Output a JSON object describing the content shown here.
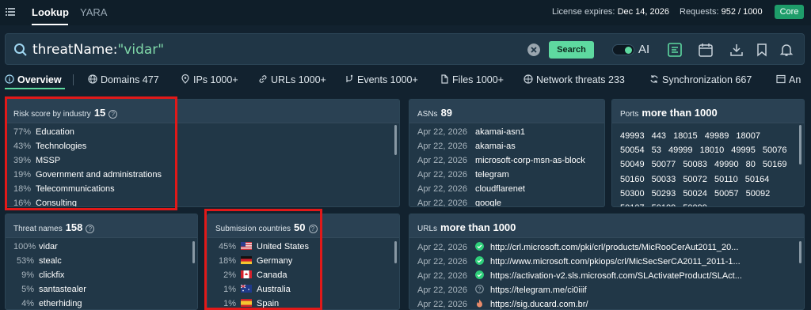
{
  "topbar": {
    "tabs": [
      "Lookup",
      "YARA"
    ],
    "license_label": "License expires:",
    "license_date": "Dec 14, 2026",
    "requests_label": "Requests:",
    "requests_value": "952 / 1000",
    "plan_badge": "Core"
  },
  "search": {
    "query_key": "threatName:",
    "query_value": "\"vidar\"",
    "button_label": "Search",
    "ai_label": "AI"
  },
  "nav": {
    "overview": "Overview",
    "domains": "Domains 477",
    "ips": "IPs 1000+",
    "urls": "URLs 1000+",
    "events": "Events 1000+",
    "files": "Files 1000+",
    "network_threats": "Network threats 233",
    "synchronization": "Synchronization 667",
    "an": "An"
  },
  "industry": {
    "title": "Risk score by industry",
    "count": "15",
    "rows": [
      {
        "pct": "77%",
        "name": "Education"
      },
      {
        "pct": "43%",
        "name": "Technologies"
      },
      {
        "pct": "39%",
        "name": "MSSP"
      },
      {
        "pct": "19%",
        "name": "Government and administrations"
      },
      {
        "pct": "18%",
        "name": "Telecommunications"
      },
      {
        "pct": "16%",
        "name": "Consulting"
      }
    ]
  },
  "asns": {
    "title": "ASNs",
    "count": "89",
    "rows": [
      {
        "date": "Apr 22, 2026",
        "name": "akamai-asn1"
      },
      {
        "date": "Apr 22, 2026",
        "name": "akamai-as"
      },
      {
        "date": "Apr 22, 2026",
        "name": "microsoft-corp-msn-as-block"
      },
      {
        "date": "Apr 22, 2026",
        "name": "telegram"
      },
      {
        "date": "Apr 22, 2026",
        "name": "cloudflarenet"
      },
      {
        "date": "Apr 22, 2026",
        "name": "google"
      }
    ]
  },
  "ports": {
    "title": "Ports",
    "count": "more than 1000",
    "values": [
      "49993",
      "443",
      "18015",
      "49989",
      "18007",
      "50054",
      "53",
      "49999",
      "18010",
      "49995",
      "50076",
      "50049",
      "50077",
      "50083",
      "49990",
      "80",
      "50169",
      "50160",
      "50033",
      "50072",
      "50110",
      "50164",
      "50300",
      "50293",
      "50024",
      "50057",
      "50092",
      "50107",
      "50109",
      "50099"
    ]
  },
  "threat_names": {
    "title": "Threat names",
    "count": "158",
    "rows": [
      {
        "pct": "100%",
        "name": "vidar"
      },
      {
        "pct": "53%",
        "name": "stealc"
      },
      {
        "pct": "9%",
        "name": "clickfix"
      },
      {
        "pct": "5%",
        "name": "santastealer"
      },
      {
        "pct": "4%",
        "name": "etherhiding"
      }
    ]
  },
  "countries": {
    "title": "Submission countries",
    "count": "50",
    "rows": [
      {
        "pct": "45%",
        "name": "United States"
      },
      {
        "pct": "18%",
        "name": "Germany"
      },
      {
        "pct": "2%",
        "name": "Canada"
      },
      {
        "pct": "1%",
        "name": "Australia"
      },
      {
        "pct": "1%",
        "name": "Spain"
      }
    ]
  },
  "urls": {
    "title": "URLs",
    "count": "more than 1000",
    "rows": [
      {
        "date": "Apr 22, 2026",
        "url": "http://crl.microsoft.com/pki/crl/products/MicRooCerAut2011_20..."
      },
      {
        "date": "Apr 22, 2026",
        "url": "http://www.microsoft.com/pkiops/crl/MicSecSerCA2011_2011-1..."
      },
      {
        "date": "Apr 22, 2026",
        "url": "https://activation-v2.sls.microsoft.com/SLActivateProduct/SLAct..."
      },
      {
        "date": "Apr 22, 2026",
        "url": "https://telegram.me/ci0iiif"
      },
      {
        "date": "Apr 22, 2026",
        "url": "https://sig.ducard.com.br/"
      }
    ]
  },
  "colors": {
    "accent": "#5ed9a0",
    "highlight_box": "#e11919",
    "url_ok": "#2fcf7a",
    "url_unknown": "#8898a4",
    "url_malicious": "#e88b6a"
  }
}
